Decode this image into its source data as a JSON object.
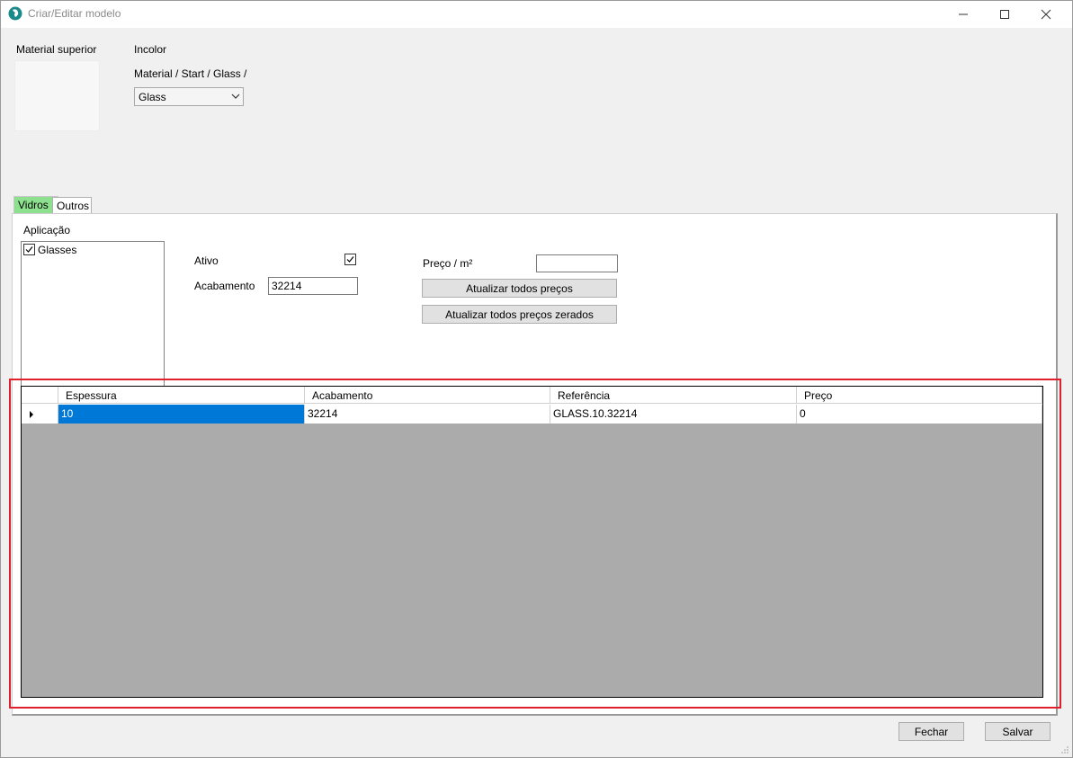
{
  "window": {
    "title": "Criar/Editar modelo",
    "minimize_icon": "minimize-icon",
    "maximize_icon": "maximize-icon",
    "close_icon": "close-icon"
  },
  "top": {
    "material_superior_label": "Material superior",
    "color_label": "Incolor",
    "path_label": "Material / Start / Glass /",
    "material_select": {
      "selected": "Glass"
    }
  },
  "tabs": [
    {
      "label": "Vidros",
      "active": true
    },
    {
      "label": "Outros",
      "active": false
    }
  ],
  "panel": {
    "aplicacao_label": "Aplicação",
    "applications": [
      {
        "label": "Glasses",
        "checked": true
      }
    ],
    "ativo_label": "Ativo",
    "ativo_checked": true,
    "acabamento_label": "Acabamento",
    "acabamento_value": "32214",
    "preco_label": "Preço / m²",
    "preco_value": "",
    "update_all_button": "Atualizar todos preços",
    "update_zero_button": "Atualizar todos preços zerados"
  },
  "grid": {
    "columns": [
      "Espessura",
      "Acabamento",
      "Referência",
      "Preço"
    ],
    "rows": [
      [
        "10",
        "32214",
        "GLASS.10.32214",
        "0"
      ]
    ]
  },
  "footer": {
    "close_button": "Fechar",
    "save_button": "Salvar"
  },
  "colors": {
    "active_tab": "#8de08d",
    "selection": "#0078d7",
    "highlight_frame": "#e0202c",
    "grid_background": "#ababab"
  }
}
